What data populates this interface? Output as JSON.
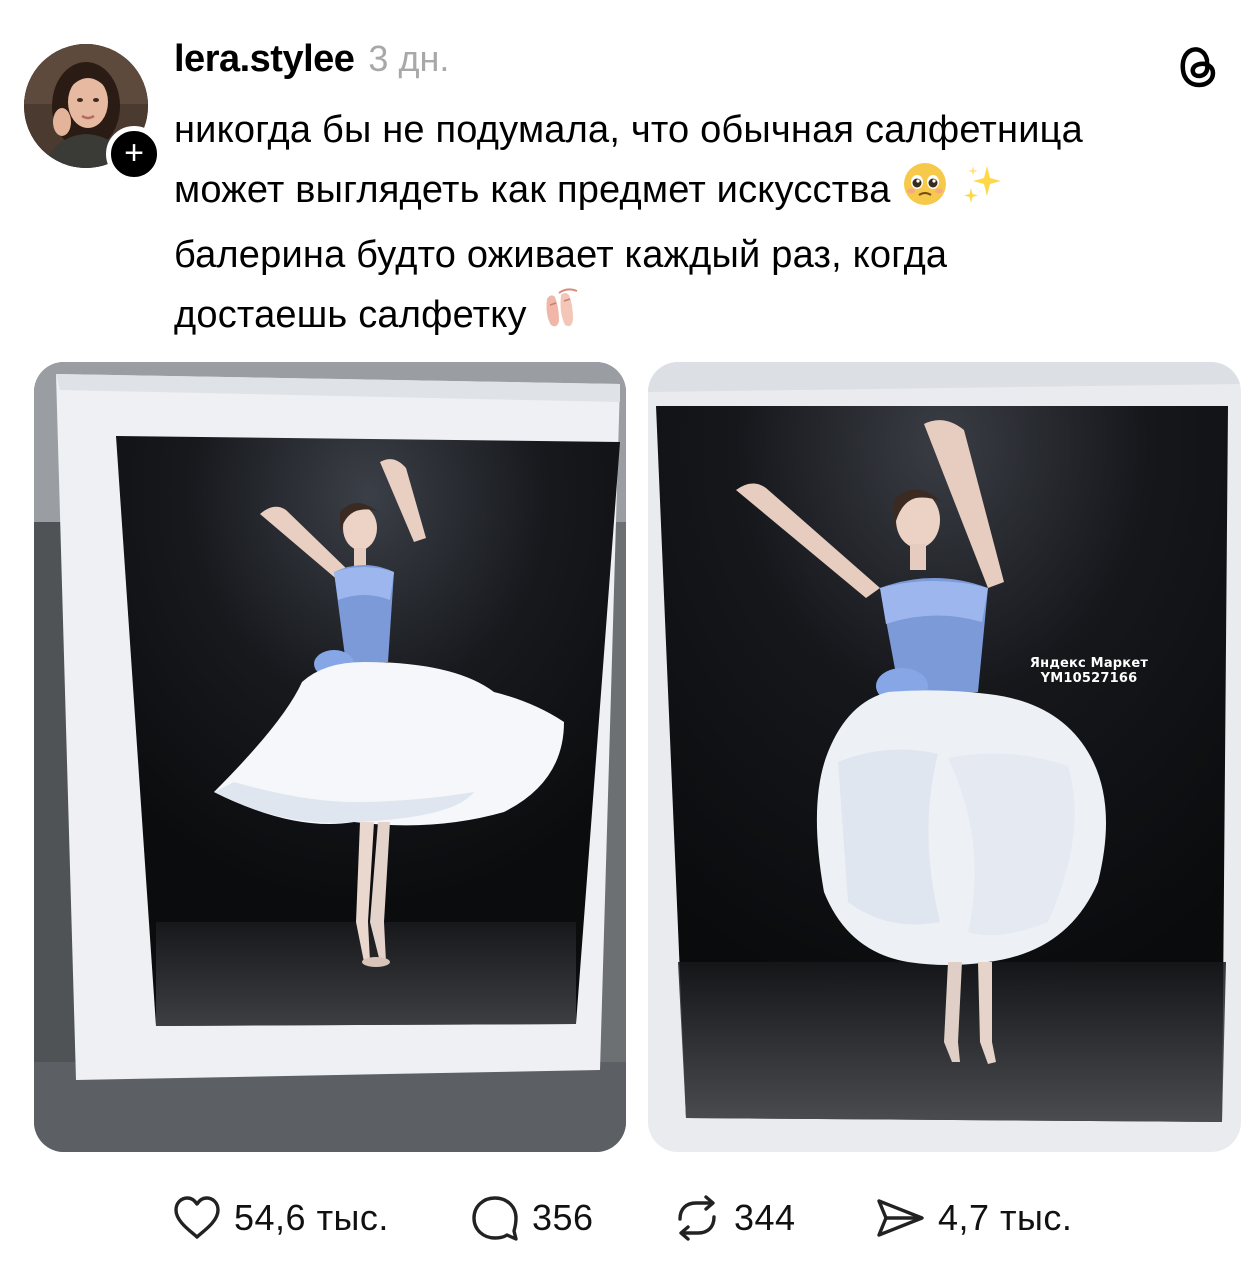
{
  "post": {
    "username": "lera.stylee",
    "time": "3 дн.",
    "text_lines": [
      "никогда бы не подумала, что обычная салфетница",
      "может выглядеть как предмет искусства",
      "балерина будто оживает каждый раз, когда",
      "достаешь салфетку"
    ],
    "follow_badge": "+",
    "emojis": [
      "pleading-face",
      "sparkles",
      "ballet-shoes"
    ]
  },
  "media": {
    "watermark_line1": "Яндекс Маркет",
    "watermark_line2": "YM10527166"
  },
  "actions": {
    "likes": "54,6 тыс.",
    "replies": "356",
    "reposts": "344",
    "shares": "4,7 тыс."
  },
  "icons": {
    "app_logo": "threads-logo-icon",
    "like": "heart-icon",
    "reply": "speech-bubble-icon",
    "repost": "repost-arrows-icon",
    "share": "paper-plane-icon"
  },
  "colors": {
    "text": "#000000",
    "muted": "#a8a8a8",
    "background": "#ffffff"
  }
}
